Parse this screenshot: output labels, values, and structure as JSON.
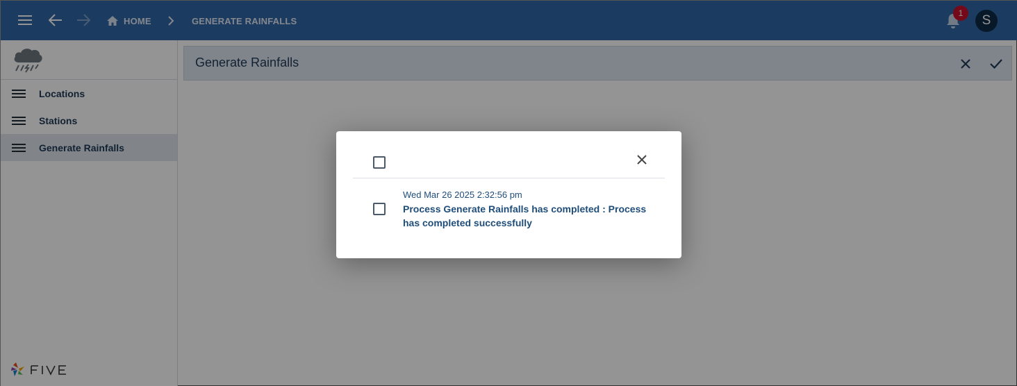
{
  "topbar": {
    "breadcrumb_home": "HOME",
    "breadcrumb_current": "GENERATE RAINFALLS",
    "notification_count": "1",
    "avatar_initial": "S"
  },
  "sidebar": {
    "items": [
      {
        "label": "Locations",
        "active": false
      },
      {
        "label": "Stations",
        "active": false
      },
      {
        "label": "Generate Rainfalls",
        "active": true
      }
    ]
  },
  "form": {
    "title": "Generate Rainfalls"
  },
  "dialog": {
    "notifications": [
      {
        "timestamp": "Wed Mar 26 2025 2:32:56 pm",
        "message": "Process Generate Rainfalls has completed : Process has completed successfully"
      }
    ]
  },
  "colors": {
    "topbar": "#2f66a8",
    "badge": "#c8102e",
    "avatar": "#0d2b45",
    "text_primary": "#1f3a57"
  },
  "icons": [
    "menu-icon",
    "back-arrow-icon",
    "forward-arrow-icon",
    "home-icon",
    "chevron-right-icon",
    "bell-icon",
    "close-icon",
    "check-icon",
    "rain-cloud-icon",
    "five-logo-icon"
  ]
}
